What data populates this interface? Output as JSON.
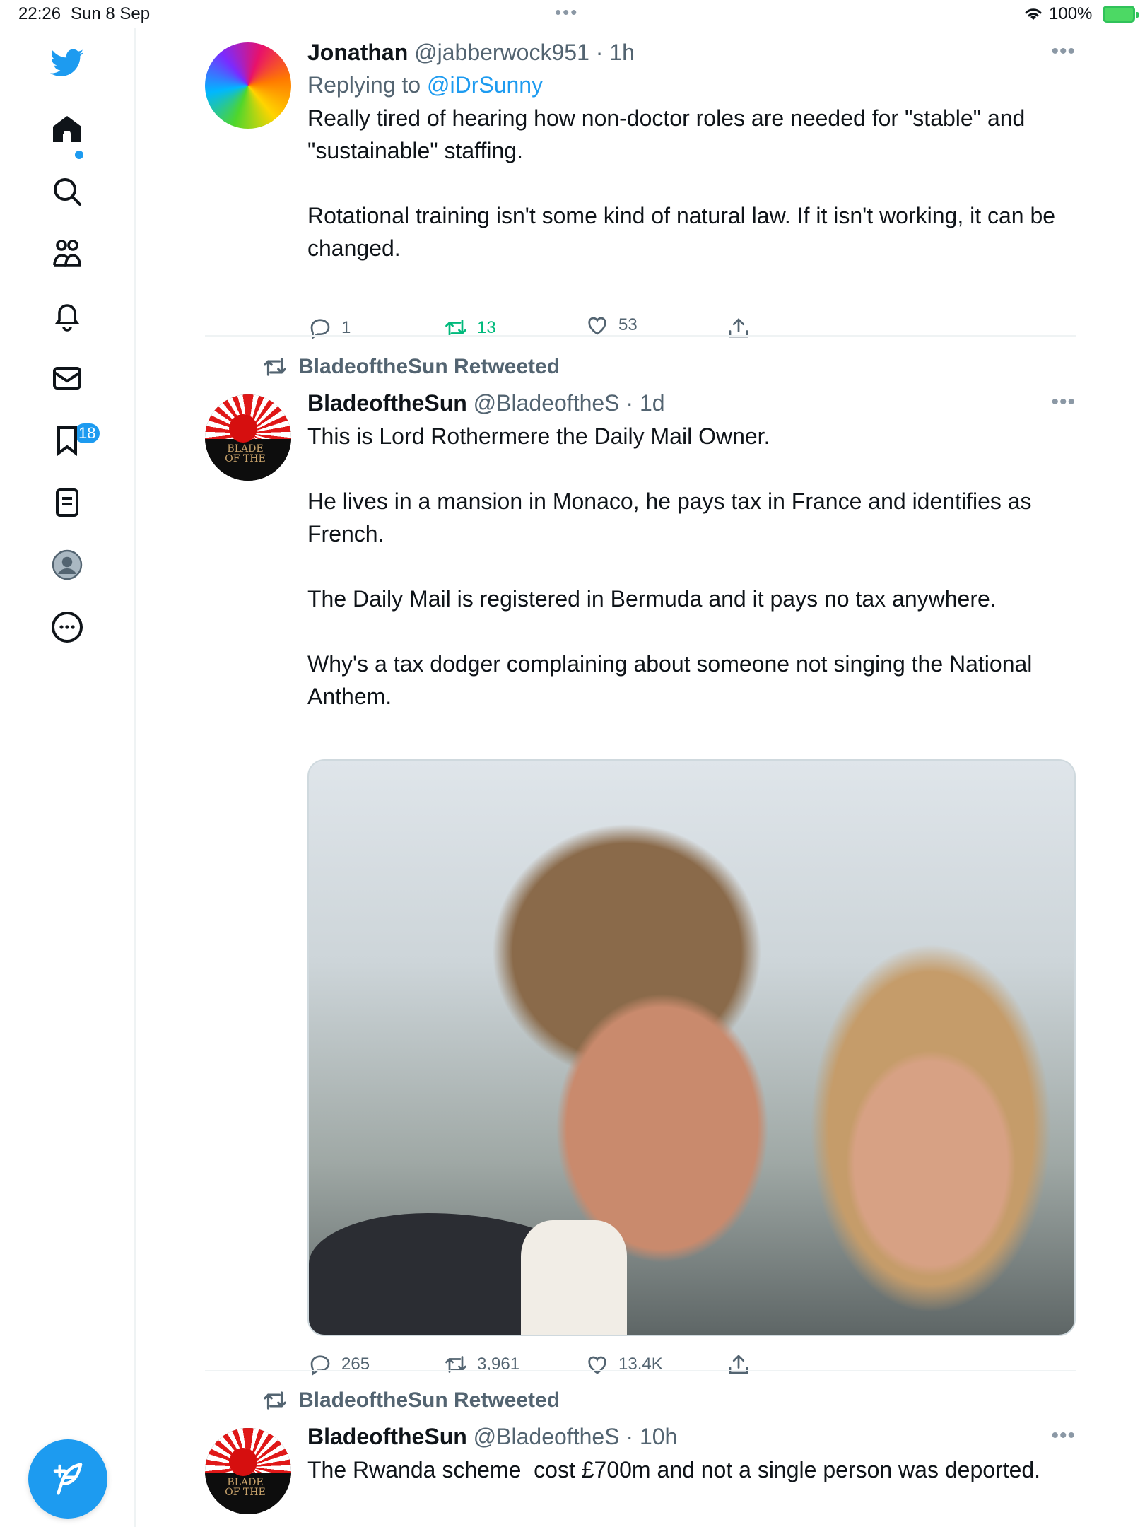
{
  "status_bar": {
    "time": "22:26",
    "date": "Sun 8 Sep",
    "battery": "100%"
  },
  "sidebar": {
    "notifications_badge": "18",
    "accent": "#1d9bf0"
  },
  "tweets": [
    {
      "name": "Jonathan",
      "handle": "@jabberwock951",
      "time": "1h",
      "replying_prefix": "Replying to ",
      "replying_to": "@iDrSunny",
      "text": "Really tired of hearing how non-doctor roles are needed for \"stable\" and \"sustainable\" staffing.\n\nRotational training isn't some kind of natural law. If it isn't working, it can be changed.",
      "replies": "1",
      "retweets": "13",
      "likes": "53"
    },
    {
      "retweeted_by": "BladeoftheSun Retweeted",
      "name": "BladeoftheSun",
      "handle": "@BladeoftheS",
      "time": "1d",
      "avatar_text": "BLADE OF THE",
      "text": "This is Lord Rothermere the Daily Mail Owner.\n\nHe lives in a mansion in Monaco, he pays tax in France and identifies as French.\n\nThe Daily Mail is registered in Bermuda and it pays no tax anywhere.\n\nWhy's a tax dodger complaining about someone not singing the National Anthem.",
      "replies": "265",
      "retweets": "3,961",
      "likes": "13.4K"
    },
    {
      "retweeted_by": "BladeoftheSun Retweeted",
      "name": "BladeoftheSun",
      "handle": "@BladeoftheS",
      "time": "10h",
      "avatar_text": "BLADE OF THE",
      "text": "The Rwanda scheme  cost £700m and not a single person was deported."
    }
  ]
}
